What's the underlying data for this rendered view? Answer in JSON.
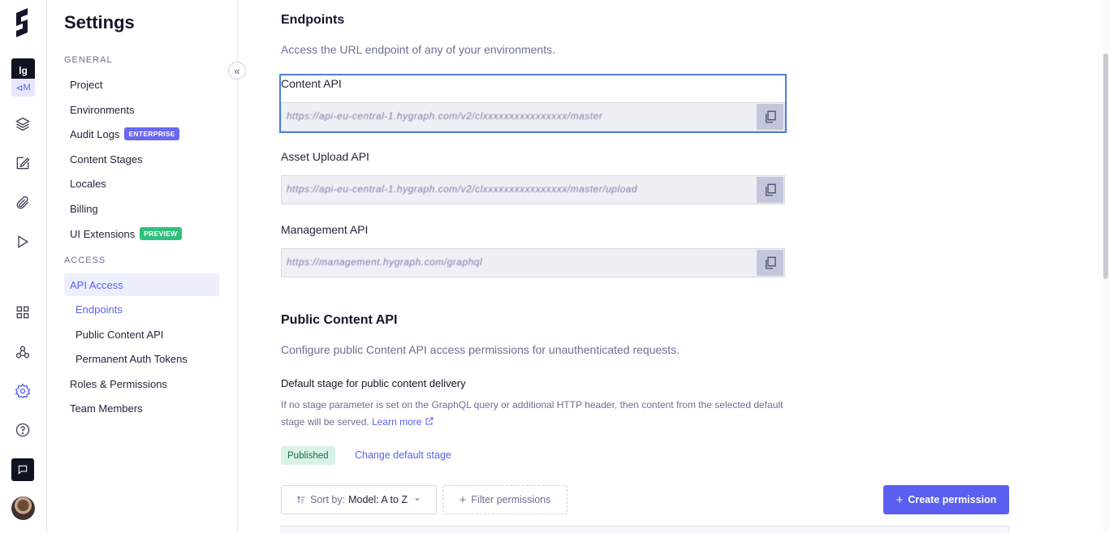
{
  "rail": {
    "project_initials": "lg",
    "environment_initial": "M",
    "icons": [
      "logo-icon",
      "layers-icon",
      "edit-icon",
      "paperclip-icon",
      "play-icon",
      "apps-icon",
      "webhooks-icon",
      "settings-icon",
      "help-icon",
      "chat-icon",
      "avatar"
    ]
  },
  "sidebar": {
    "title": "Settings",
    "general_label": "GENERAL",
    "access_label": "ACCESS",
    "items": {
      "project": "Project",
      "environments": "Environments",
      "audit_logs": "Audit Logs",
      "audit_logs_tag": "ENTERPRISE",
      "content_stages": "Content Stages",
      "locales": "Locales",
      "billing": "Billing",
      "ui_extensions": "UI Extensions",
      "ui_extensions_tag": "PREVIEW",
      "api_access": "API Access",
      "endpoints": "Endpoints",
      "public_content_api": "Public Content API",
      "permanent_auth_tokens": "Permanent Auth Tokens",
      "roles_permissions": "Roles & Permissions",
      "team_members": "Team Members"
    },
    "collapse_glyph": "«"
  },
  "endpoints": {
    "title": "Endpoints",
    "description": "Access the URL endpoint of any of your environments.",
    "content_api_label": "Content API",
    "content_api_value": "https://api-eu-central-1.hygraph.com/v2/clxxxxxxxxxxxxxxxx/master",
    "asset_upload_label": "Asset Upload API",
    "asset_upload_value": "https://api-eu-central-1.hygraph.com/v2/clxxxxxxxxxxxxxxxx/master/upload",
    "management_label": "Management API",
    "management_value": "https://management.hygraph.com/graphql"
  },
  "public_api": {
    "title": "Public Content API",
    "description": "Configure public Content API access permissions for unauthenticated requests.",
    "default_stage_heading": "Default stage for public content delivery",
    "help_text": "If no stage parameter is set on the GraphQL query or additional HTTP header, then content from the selected default stage will be served.",
    "learn_more": "Learn more",
    "stage_pill": "Published",
    "change_stage": "Change default stage",
    "sort_prefix": "Sort by:",
    "sort_value": "Model: A to Z",
    "filter_label": "Filter permissions",
    "create_label": "Create permission"
  },
  "colors": {
    "accent": "#5b5ff0",
    "focus": "#4d7fd1",
    "published_bg": "#d8f3e6"
  }
}
